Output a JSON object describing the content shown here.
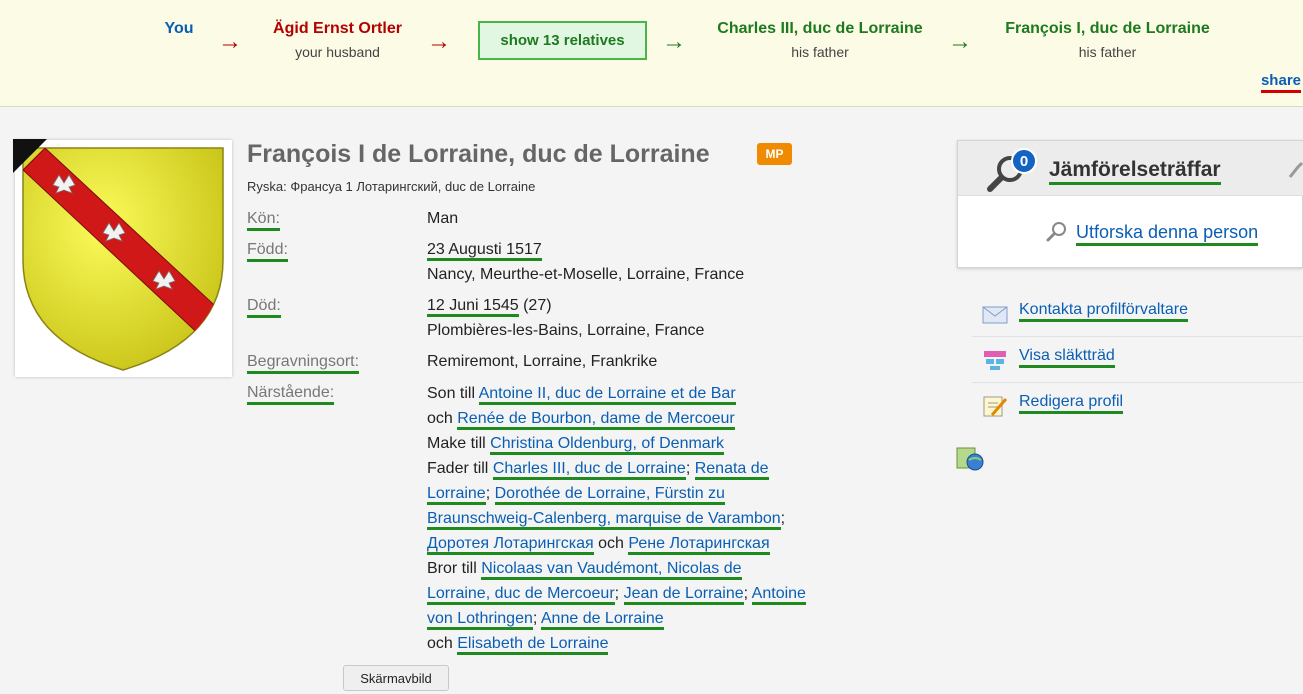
{
  "relationship_path": {
    "you": "You",
    "husband": {
      "name": "Ägid Ernst Ortler",
      "role": "your husband"
    },
    "show_relatives": "show 13 relatives",
    "father1": {
      "name": "Charles III, duc de Lorraine",
      "role": "his father"
    },
    "father2": {
      "name": "François I, duc de Lorraine",
      "role": "his father"
    },
    "arrow": "→",
    "share": "share"
  },
  "profile": {
    "title": "François I de Lorraine, duc de Lorraine",
    "badge": "MP",
    "alt_name": "Ryska: Франсуа 1 Лотарингский, duc de Lorraine",
    "fields": {
      "gender_label": "Kön:",
      "gender_value": "Man",
      "born_label": "Född:",
      "born_date": "23 Augusti 1517",
      "born_place": "Nancy, Meurthe-et-Moselle, Lorraine, France",
      "died_label": "Död:",
      "died_date": "12 Juni 1545",
      "died_age": " (27)",
      "died_place": "Plombières-les-Bains, Lorraine, France",
      "burial_label": "Begravningsort:",
      "burial_value": "Remiremont, Lorraine, Frankrike",
      "relatives_label": "Närstående:"
    },
    "relatives": {
      "son_of": "Son till",
      "father": "Antoine II, duc de Lorraine et de Bar",
      "and": "och",
      "mother": "Renée de Bourbon, dame de Mercoeur",
      "spouse_of": "Make till",
      "spouse": "Christina Oldenburg, of Denmark",
      "father_of": "Fader till",
      "children": [
        "Charles III, duc de Lorraine",
        "Renata de Lorraine",
        "Dorothée de Lorraine, Fürstin zu Braunschweig-Calenberg, marquise de Varambon",
        "Доротея Лотарингская",
        "Рене Лотарингская"
      ],
      "brother_of": "Bror till",
      "siblings": [
        "Nicolaas van Vaudémont, Nicolas de Lorraine, duc de Mercoeur",
        "Jean de Lorraine",
        "Antoine von Lothringen",
        "Anne de Lorraine",
        "Elisabeth de Lorraine"
      ],
      "sep": ";",
      "och_partial": "och"
    }
  },
  "sidebar": {
    "match_count": "0",
    "match_title": "Jämförelseträffar",
    "explore": "Utforska denna person",
    "contact": "Kontakta profilförvaltare",
    "tree": "Visa släktträd",
    "edit": "Redigera profil"
  },
  "tooltip": "Skärmavbild",
  "colors": {
    "link": "#0a5fb4",
    "underline": "#1f8a1f",
    "brand_red": "#b30000",
    "bar_bg": "#fbfbe6"
  }
}
